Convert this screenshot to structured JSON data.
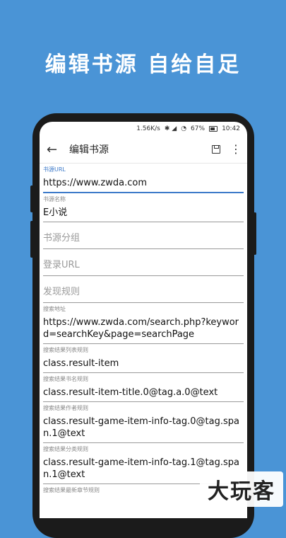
{
  "promo": {
    "headline": "编辑书源  自给自足"
  },
  "status_bar": {
    "speed": "1.56K/s",
    "battery": "67%",
    "time": "10:42"
  },
  "toolbar": {
    "title": "编辑书源"
  },
  "fields": [
    {
      "label": "书源URL",
      "value": "https://www.zwda.com"
    },
    {
      "label": "书源名称",
      "value": "E小说"
    },
    {
      "placeholder": "书源分组"
    },
    {
      "placeholder": "登录URL"
    },
    {
      "placeholder": "发现规则"
    },
    {
      "label": "搜索地址",
      "value": "https://www.zwda.com/search.php?keyword=searchKey&page=searchPage"
    },
    {
      "label": "搜索结果列表规则",
      "value": "class.result-item"
    },
    {
      "label": "搜索结果书名规则",
      "value": "class.result-item-title.0@tag.a.0@text"
    },
    {
      "label": "搜索结果作者规则",
      "value": "class.result-game-item-info-tag.0@tag.span.1@text"
    },
    {
      "label": "搜索结果分类规则",
      "value": "class.result-game-item-info-tag.1@tag.span.1@text"
    },
    {
      "label": "搜索结果最新章节规则"
    }
  ],
  "watermark": {
    "text": "大玩客"
  },
  "colors": {
    "background": "#4a94d6",
    "accent": "#3d7ac9"
  }
}
